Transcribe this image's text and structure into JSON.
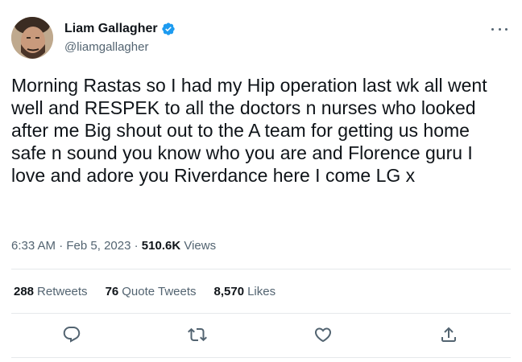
{
  "user": {
    "display_name": "Liam Gallagher",
    "handle": "@liamgallagher",
    "verified": true
  },
  "tweet": {
    "text": "Morning Rastas so I had my Hip operation last wk all went well and RESPEK to all the doctors n nurses who looked after me Big shout out to the A team for getting us home safe n sound you know who you are and Florence guru I love and adore you Riverdance here I come LG x",
    "time": "6:33 AM",
    "date": "Feb 5, 2023",
    "separator": "·",
    "views_count": "510.6K",
    "views_label": "Views"
  },
  "stats": {
    "retweets_count": "288",
    "retweets_label": "Retweets",
    "quotes_count": "76",
    "quotes_label": "Quote Tweets",
    "likes_count": "8,570",
    "likes_label": "Likes"
  },
  "icons": {
    "more": "more-icon",
    "verified": "verified-badge-icon",
    "reply": "reply-icon",
    "retweet": "retweet-icon",
    "like": "like-icon",
    "share": "share-icon"
  },
  "colors": {
    "text_primary": "#0f1419",
    "text_secondary": "#536471",
    "verified_blue": "#1d9bf0",
    "divider": "#e6e9eb"
  }
}
